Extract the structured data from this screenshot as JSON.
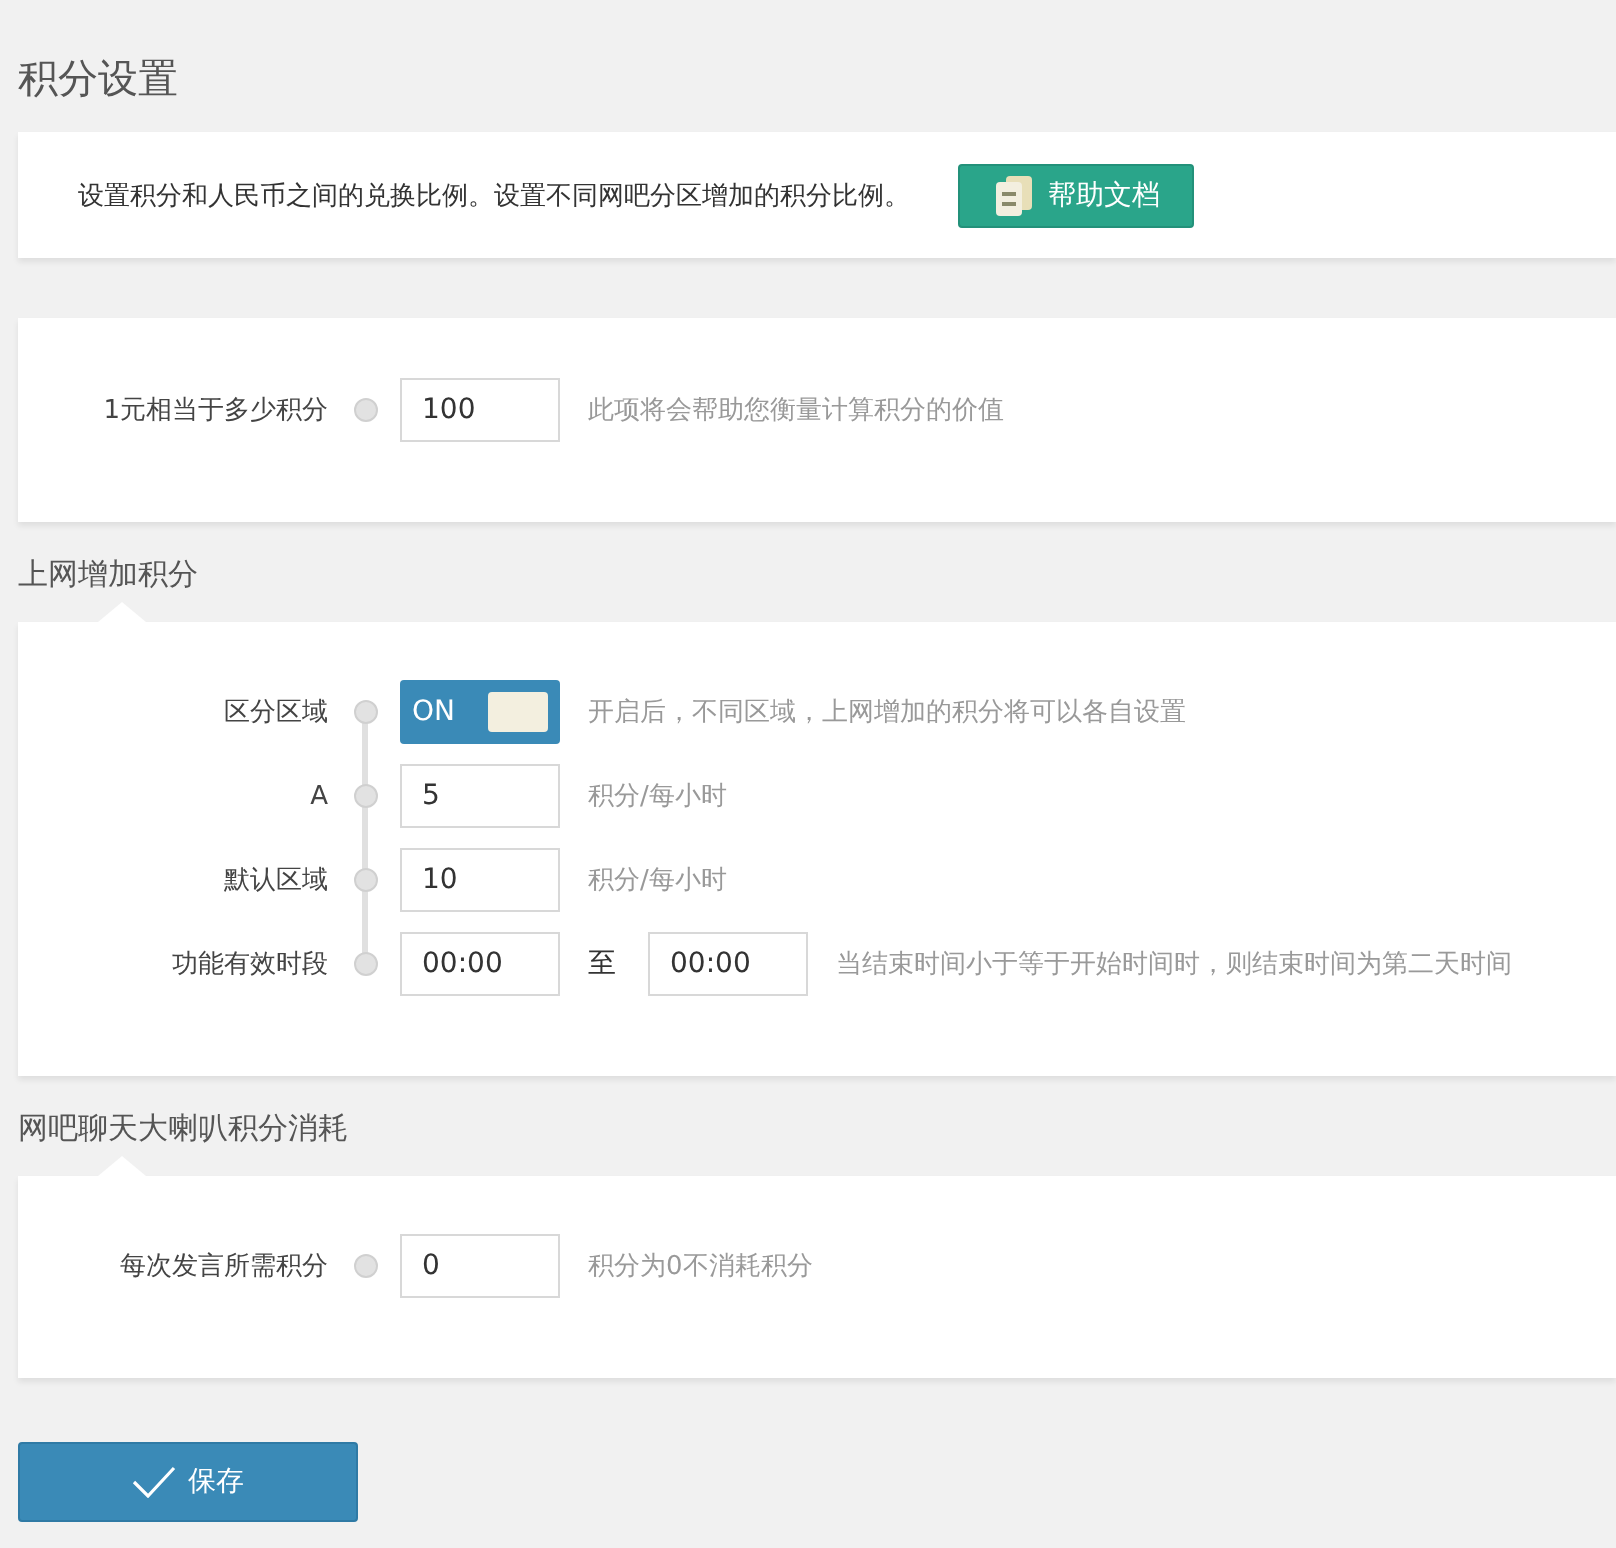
{
  "page_title": "积分设置",
  "intro": {
    "text": "设置积分和人民币之间的兑换比例。设置不同网吧分区增加的积分比例。",
    "help_button": "帮助文档"
  },
  "sections": [
    {
      "rows": [
        {
          "kind": "input",
          "label": "1元相当于多少积分",
          "value": "100",
          "hint": "此项将会帮助您衡量计算积分的价值"
        }
      ]
    },
    {
      "title": "上网增加积分",
      "rows": [
        {
          "kind": "toggle",
          "label": "区分区域",
          "on": true,
          "toggle_text": "ON",
          "hint": "开启后，不同区域，上网增加的积分将可以各自设置"
        },
        {
          "kind": "input",
          "label": "A",
          "value": "5",
          "hint": "积分/每小时"
        },
        {
          "kind": "input",
          "label": "默认区域",
          "value": "10",
          "hint": "积分/每小时"
        },
        {
          "kind": "range",
          "label": "功能有效时段",
          "value": "00:00",
          "separator": "至",
          "value_end": "00:00",
          "hint": "当结束时间小于等于开始时间时，则结束时间为第二天时间"
        }
      ]
    },
    {
      "title": "网吧聊天大喇叭积分消耗",
      "rows": [
        {
          "kind": "input",
          "label": "每次发言所需积分",
          "value": "0",
          "hint": "积分为0不消耗积分"
        }
      ]
    }
  ],
  "save_button": "保存"
}
